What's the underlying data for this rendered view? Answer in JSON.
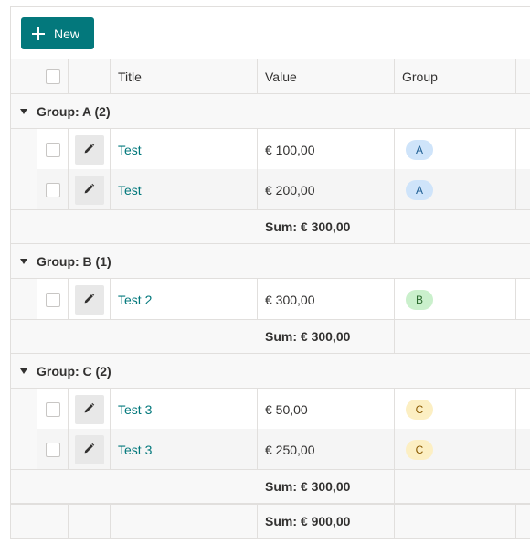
{
  "toolbar": {
    "new_label": "New"
  },
  "columns": {
    "title": "Title",
    "value": "Value",
    "group": "Group"
  },
  "groups": [
    {
      "label": "Group: A (2)",
      "rows": [
        {
          "title": "Test",
          "value": "€ 100,00",
          "group": "A"
        },
        {
          "title": "Test",
          "value": "€ 200,00",
          "group": "A"
        }
      ],
      "sum": "Sum: € 300,00"
    },
    {
      "label": "Group: B (1)",
      "rows": [
        {
          "title": "Test 2",
          "value": "€ 300,00",
          "group": "B"
        }
      ],
      "sum": "Sum: € 300,00"
    },
    {
      "label": "Group: C (2)",
      "rows": [
        {
          "title": "Test 3",
          "value": "€ 50,00",
          "group": "C"
        },
        {
          "title": "Test 3",
          "value": "€ 250,00",
          "group": "C"
        }
      ],
      "sum": "Sum: € 300,00"
    }
  ],
  "total_sum": "Sum: € 900,00",
  "pill_colors": {
    "A": {
      "bg": "#cfe4fa",
      "fg": "#1f5f94"
    },
    "B": {
      "bg": "#caf0cc",
      "fg": "#2c6b2f"
    },
    "C": {
      "bg": "#fcefc3",
      "fg": "#8a5a00"
    }
  },
  "icons": {
    "new": "plus-icon",
    "collapse": "caret-down-icon",
    "edit": "pencil-icon"
  }
}
